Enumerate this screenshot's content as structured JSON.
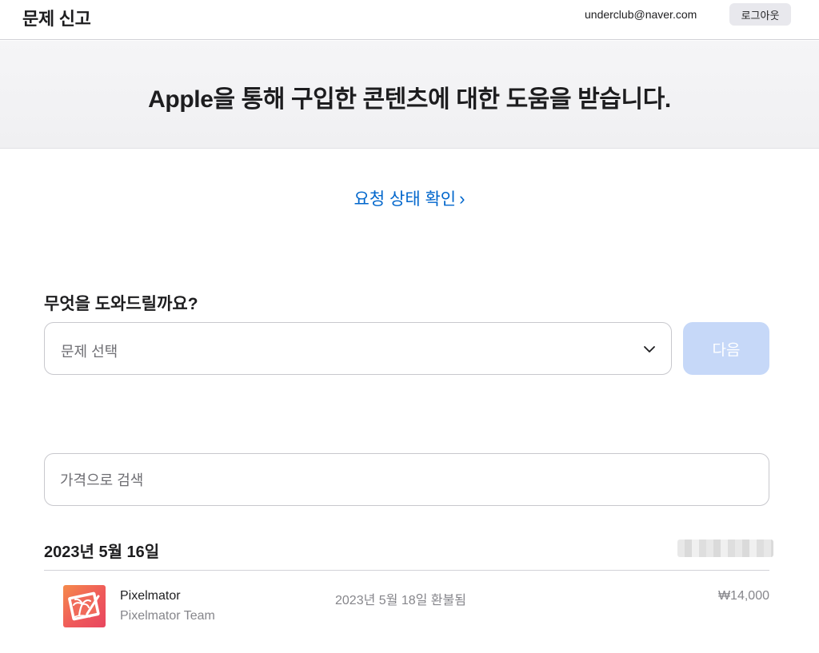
{
  "header": {
    "title": "문제 신고",
    "email": "underclub@naver.com",
    "logout_label": "로그아웃"
  },
  "hero": {
    "heading": "Apple을 통해 구입한 콘텐츠에 대한 도움을 받습니다."
  },
  "status_link": {
    "label": "요청 상태 확인",
    "chevron": "›"
  },
  "help": {
    "question": "무엇을 도와드릴까요?",
    "select_placeholder": "문제 선택",
    "next_label": "다음"
  },
  "search": {
    "placeholder": "가격으로 검색"
  },
  "purchases": [
    {
      "date": "2023년 5월 16일",
      "items": [
        {
          "icon": "pixelmator-app-icon",
          "name": "Pixelmator",
          "developer": "Pixelmator Team",
          "status": "2023년 5월 18일 환불됨",
          "price": "₩14,000"
        }
      ]
    }
  ],
  "colors": {
    "link": "#0066cc",
    "next_button_disabled": "#c6d8f8",
    "hero_bg": "#f5f5f7"
  }
}
